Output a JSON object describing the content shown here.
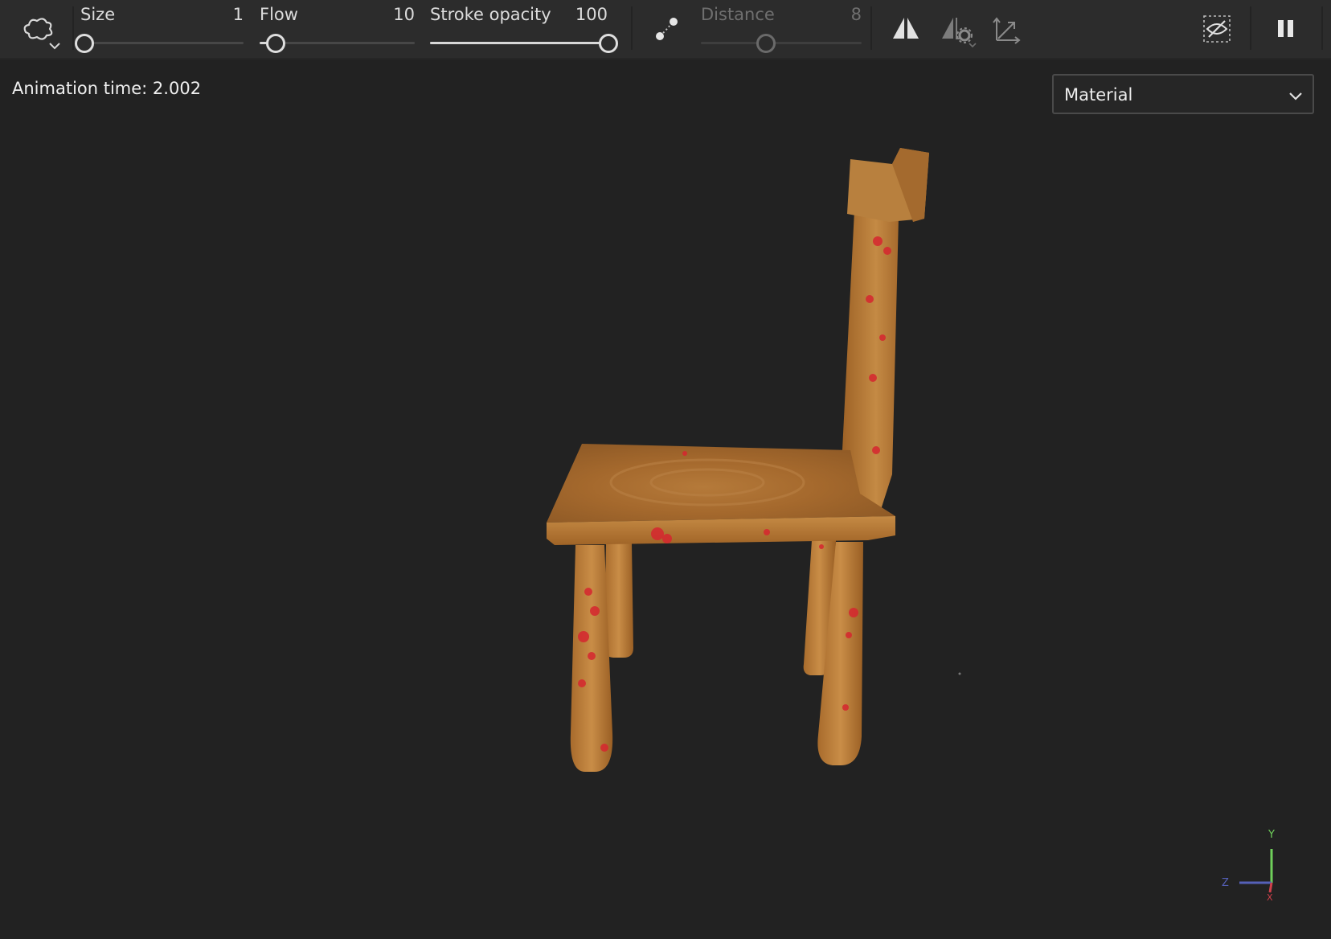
{
  "toolbar": {
    "tool_icon": "brush-shape-icon",
    "size": {
      "label": "Size",
      "value": "1",
      "fraction": 0.02
    },
    "flow": {
      "label": "Flow",
      "value": "10",
      "fraction": 0.1
    },
    "stroke_opacity": {
      "label": "Stroke opacity",
      "value": "100",
      "fraction": 1.0
    },
    "lazy_mouse_icon": "lazy-mouse-icon",
    "distance": {
      "label": "Distance",
      "value": "8",
      "fraction": 0.4,
      "enabled": false
    },
    "symmetry_icon": "symmetry-icon",
    "symmetry_settings_icon": "symmetry-settings-icon",
    "transform_icon": "transform-icon",
    "visibility_icon": "hide-icon",
    "pause_icon": "pause-icon"
  },
  "viewport": {
    "animation_time": "Animation time: 2.002",
    "shading_mode": {
      "value": "Material"
    },
    "model": "wooden-chair-icon",
    "axis_gizmo": {
      "y": "Y",
      "z": "Z",
      "x": "X"
    }
  },
  "colors": {
    "background": "#222222",
    "toolbar": "#2c2c2c",
    "wood": "#b87a35",
    "paint": "#d6262f"
  }
}
